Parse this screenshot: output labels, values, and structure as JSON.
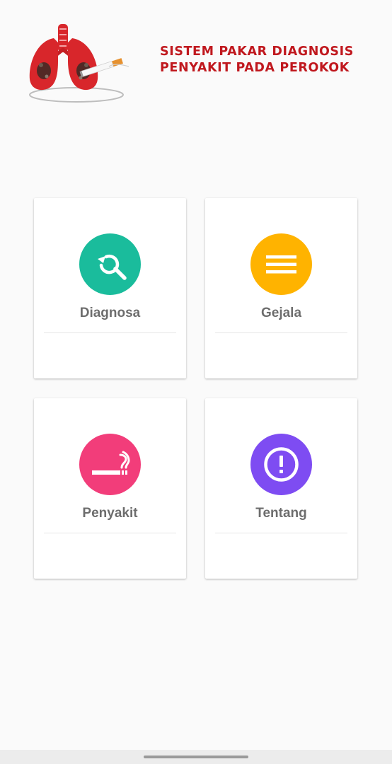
{
  "header": {
    "title_line1": "SISTEM PAKAR DIAGNOSIS",
    "title_line2": "PENYAKIT PADA PEROKOK",
    "title_color": "#c0181e",
    "logo_icon": "lungs-cigarette-icon"
  },
  "menu": [
    {
      "label": "Diagnosa",
      "icon": "search-refresh-icon",
      "color": "#1abc9c"
    },
    {
      "label": "Gejala",
      "icon": "list-icon",
      "color": "#ffb300"
    },
    {
      "label": "Penyakit",
      "icon": "smoking-icon",
      "color": "#f23d7a"
    },
    {
      "label": "Tentang",
      "icon": "info-alert-icon",
      "color": "#7e4cf2"
    }
  ]
}
